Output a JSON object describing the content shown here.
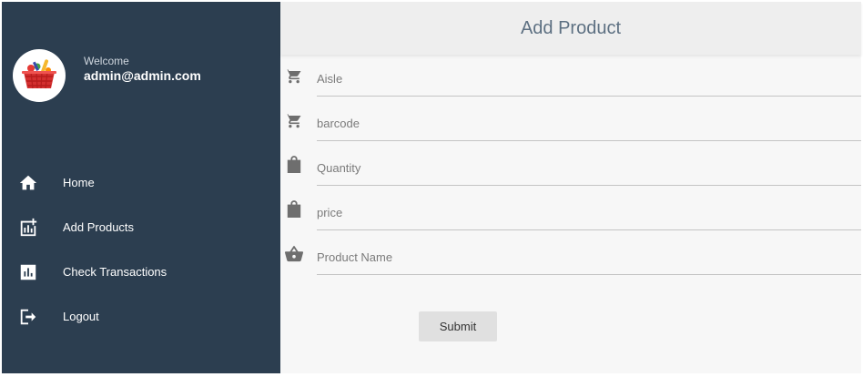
{
  "sidebar": {
    "welcome": "Welcome",
    "email": "admin@admin.com",
    "nav": [
      {
        "label": "Home",
        "icon": "home-icon"
      },
      {
        "label": "Add Products",
        "icon": "add-chart-icon"
      },
      {
        "label": "Check Transactions",
        "icon": "bar-chart-icon"
      },
      {
        "label": "Logout",
        "icon": "logout-icon"
      }
    ],
    "background_color": "#2c3e50"
  },
  "header": {
    "title": "Add Product"
  },
  "form": {
    "fields": [
      {
        "placeholder": "Aisle",
        "value": "",
        "icon": "cart-icon"
      },
      {
        "placeholder": "barcode",
        "value": "",
        "icon": "cart-icon"
      },
      {
        "placeholder": "Quantity",
        "value": "",
        "icon": "bag-icon"
      },
      {
        "placeholder": "price",
        "value": "",
        "icon": "bag-icon"
      },
      {
        "placeholder": "Product Name",
        "value": "",
        "icon": "basket-icon"
      }
    ],
    "submit_label": "Submit"
  }
}
